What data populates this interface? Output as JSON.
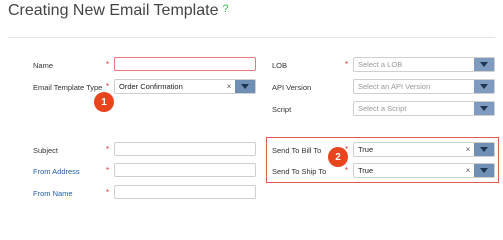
{
  "page": {
    "title": "Creating New Email Template",
    "help_icon": "?"
  },
  "left_fields": {
    "name": {
      "label": "Name",
      "required": "*",
      "value": ""
    },
    "email_template_type": {
      "label": "Email Template Type",
      "required": "*",
      "value": "Order Confirmation"
    },
    "subject": {
      "label": "Subject",
      "required": "*",
      "value": ""
    },
    "from_address": {
      "label": "From Address",
      "required": "*",
      "value": ""
    },
    "from_name": {
      "label": "From Name",
      "required": "*",
      "value": ""
    }
  },
  "right_fields": {
    "lob": {
      "label": "LOB",
      "required": "*",
      "placeholder": "Select a LOB"
    },
    "api_version": {
      "label": "API Version",
      "placeholder": "Select an API Version"
    },
    "script": {
      "label": "Script",
      "placeholder": "Select a Script"
    },
    "send_to_bill_to": {
      "label": "Send To Bill To",
      "required": "*",
      "value": "True"
    },
    "send_to_ship_to": {
      "label": "Send To Ship To",
      "required": "*",
      "value": "True"
    }
  },
  "callouts": {
    "one": "1",
    "two": "2"
  },
  "icons": {
    "clear": "clear-icon",
    "dropdown": "chevron-down-icon",
    "help": "help-circle-icon"
  },
  "colors": {
    "required": "#e0312f",
    "callout": "#e8451e",
    "highlight": "#e25a4a",
    "dropdown_button": "#6f8fb4",
    "help": "#39b54a"
  }
}
